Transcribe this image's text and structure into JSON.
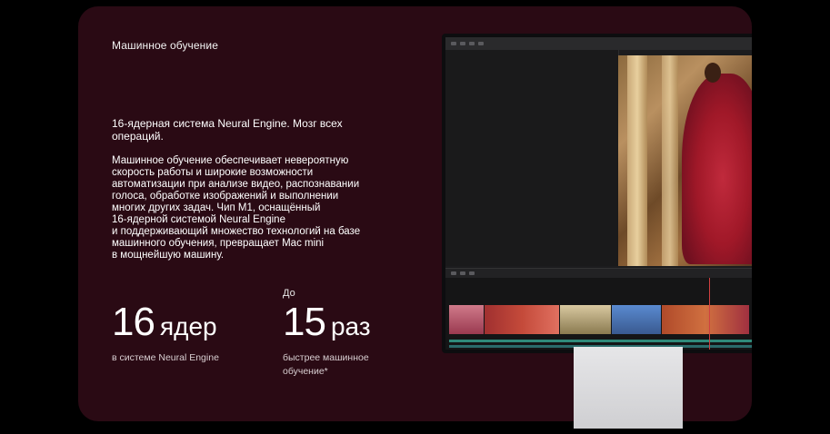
{
  "section": {
    "eyebrow": "Машинное обучение",
    "headline": "16-ядерная система Neural Engine. Мозг всех операций.",
    "body_lines": [
      "Машинное обучение обеспечивает невероятную",
      "скорость работы и широкие возможности",
      "автоматизации при анализе видео, распознавании",
      "голоса, обработке изображений и выполнении",
      "многих других задач. Чип M1, оснащённый",
      "16-ядерной системой Neural Engine",
      "и поддерживающий множество технологий на базе",
      "машинного обучения, превращает Mac mini",
      "в мощнейшую машину."
    ]
  },
  "stats": [
    {
      "prefix": "",
      "number": "16",
      "unit": "ядер",
      "caption": "в системе Neural Engine"
    },
    {
      "prefix": "До",
      "number": "15",
      "unit": "раз",
      "caption": "быстрее машинное обучение*"
    }
  ],
  "colors": {
    "page_background": "#000000",
    "card_background": "#2a0a14",
    "text": "#ffffff"
  },
  "icons": {
    "monitor": "mac-display-mockup",
    "app": "video-editor-window"
  }
}
